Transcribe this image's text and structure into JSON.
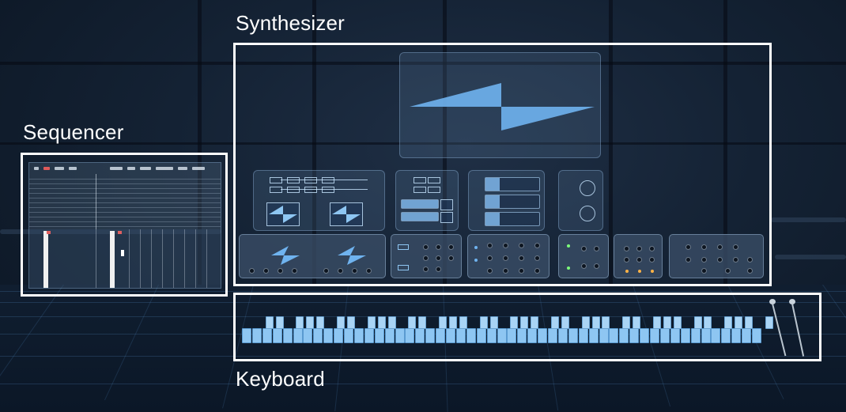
{
  "regions": {
    "sequencer_label": "Sequencer",
    "synthesizer_label": "Synthesizer",
    "keyboard_label": "Keyboard"
  },
  "colors": {
    "frame": "#ffffff",
    "key_white": "#8ec6f2",
    "key_black": "#a9d4f5",
    "panel_glass": "#6e96be",
    "wave": "#6fb3ef",
    "led_green": "#7dff7a",
    "led_amber": "#ffb347",
    "led_red": "#ff5a5a"
  },
  "icons": {
    "oscillator_waveform": "sawtooth-icon",
    "lfo": "sine-dial-icon",
    "mallets": "mallet-icon"
  }
}
